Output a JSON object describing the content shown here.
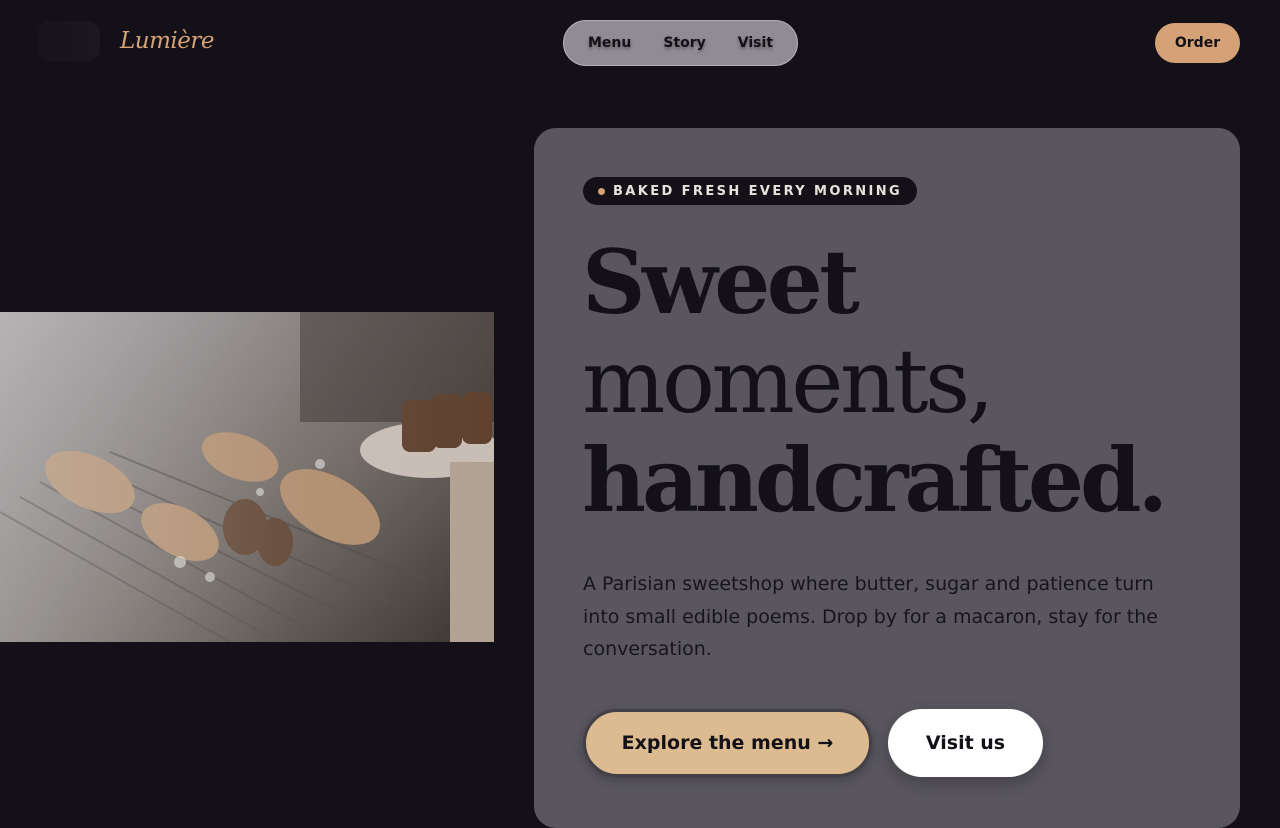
{
  "header": {
    "brand": "Lumière",
    "nav": [
      "Menu",
      "Story",
      "Visit"
    ],
    "order_label": "Order"
  },
  "hero": {
    "badge": "BAKED FRESH EVERY MORNING",
    "headline": [
      "Sweet",
      "moments,",
      "handcrafted."
    ],
    "intro": "A Parisian sweetshop where butter, sugar and patience turn into small edible poems. Drop by for a macaron, stay for the conversation.",
    "primary_cta": "Explore the menu →",
    "secondary_cta": "Visit us"
  },
  "colors": {
    "background": "#131117",
    "accent": "#d4a276",
    "card": "#59565e",
    "nav_pill": "#8f8c93"
  }
}
